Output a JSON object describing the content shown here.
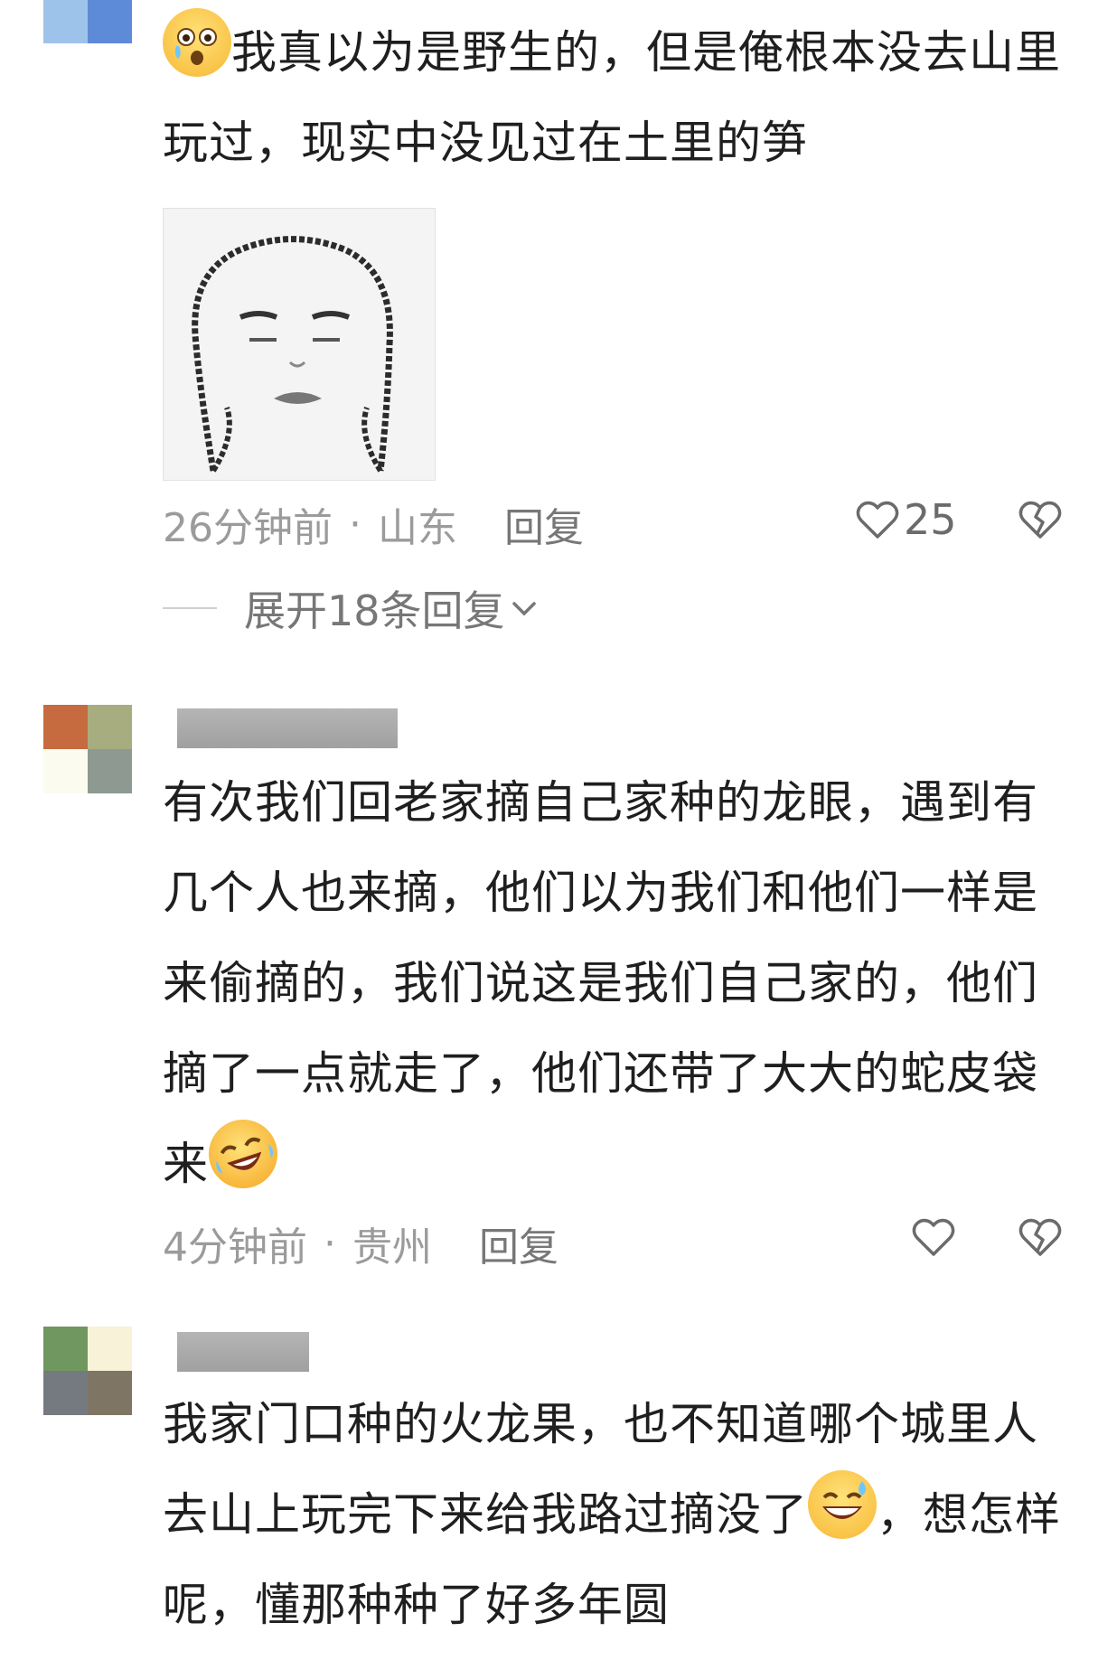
{
  "comments": [
    {
      "text": "我真以为是野生的，但是俺根本没去山里玩过，现实中没见过在土里的笋",
      "time": "26分钟前",
      "location": "山东",
      "reply_label": "回复",
      "likes": "25",
      "expand_label": "展开18条回复",
      "avatar_colors": [
        "#9ec3ea",
        "#5d8bd8"
      ]
    },
    {
      "text": "有次我们回老家摘自己家种的龙眼，遇到有几个人也来摘，他们以为我们和他们一样是来偷摘的，我们说这是我们自己家的，他们摘了一点就走了，他们还带了大大的蛇皮袋来",
      "time": "4分钟前",
      "location": "贵州",
      "reply_label": "回复",
      "avatar_colors": [
        "#c56b3f",
        "#a8ad80",
        "#fbfbf0",
        "#8d9991"
      ]
    },
    {
      "text_part1": "我家门口种的火龙果，也不知道哪个城里人去山上玩完下来给我路过摘没了",
      "text_part2": "，想怎样呢，懂那种种了好多年圆",
      "avatar_colors": [
        "#6f975f",
        "#f7f2d8",
        "#757a80",
        "#7f7565"
      ]
    }
  ],
  "icons": {
    "emoji_1": "shocked-tearful-face-icon",
    "emoji_2": "rolling-laughing-face-icon",
    "emoji_3": "grinning-sweat-face-icon",
    "like": "heart-outline-icon",
    "dislike": "broken-heart-icon",
    "expand": "chevron-down-icon"
  }
}
